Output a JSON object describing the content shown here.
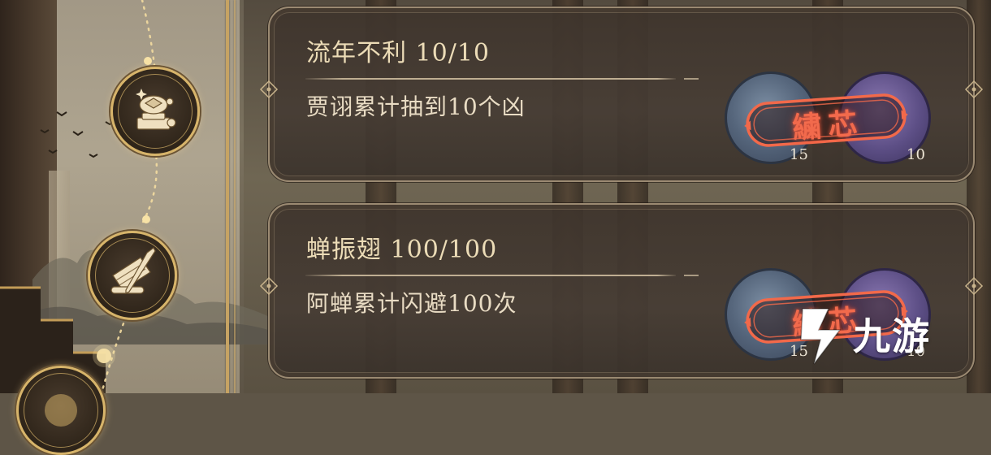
{
  "achievements": [
    {
      "title": "流年不利 10/10",
      "description": "贾诩累计抽到10个凶",
      "stamp_text": "繍芯",
      "reward_counts": [
        "15",
        "10"
      ]
    },
    {
      "title": "蝉振翅 100/100",
      "description": "阿蝉累计闪避100次",
      "stamp_text": "繍芯",
      "reward_counts": [
        "15",
        "10"
      ]
    }
  ],
  "icons": {
    "medal_1": "turtle-shell-icon",
    "medal_2": "scroll-brush-icon",
    "medal_3": "medal-icon"
  },
  "watermark": {
    "text": "九游",
    "logo": "9game-logo"
  },
  "colors": {
    "card_bg": "#3e342c",
    "card_border": "#9b8a72",
    "title_text": "#ecdcb7",
    "stamp_red": "#f26a4c",
    "medal_gold": "#d7b46a"
  }
}
